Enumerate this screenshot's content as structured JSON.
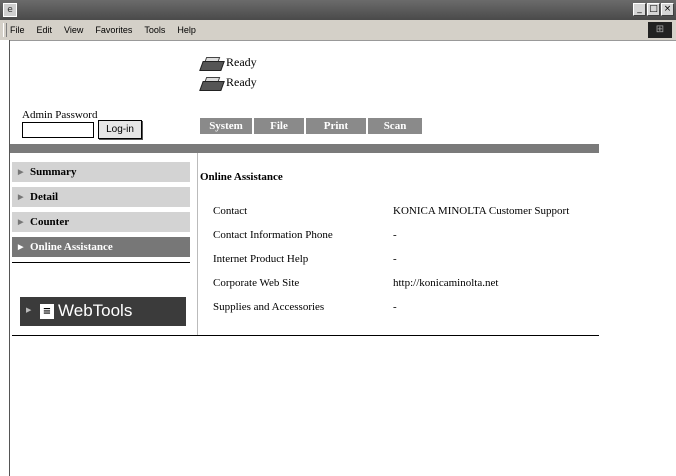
{
  "window": {
    "controls": [
      "_",
      "□",
      "×"
    ]
  },
  "menubar": {
    "items": [
      "File",
      "Edit",
      "View",
      "Favorites",
      "Tools",
      "Help"
    ]
  },
  "status": [
    {
      "icon": "printer-icon",
      "text": "Ready"
    },
    {
      "icon": "printer-icon",
      "text": "Ready"
    }
  ],
  "admin": {
    "label": "Admin Password",
    "password_value": "",
    "login_label": "Log-in"
  },
  "tabs": [
    "System",
    "File",
    "Print",
    "Scan"
  ],
  "sidebar": {
    "items": [
      {
        "label": "Summary",
        "active": false
      },
      {
        "label": "Detail",
        "active": false
      },
      {
        "label": "Counter",
        "active": false
      },
      {
        "label": "Online Assistance",
        "active": true
      }
    ],
    "webtools_label": "WebTools"
  },
  "content": {
    "title": "Online Assistance",
    "rows": [
      {
        "key": "Contact",
        "value": "KONICA MINOLTA Customer Support"
      },
      {
        "key": "Contact Information Phone",
        "value": "-"
      },
      {
        "key": "Internet Product Help",
        "value": "-"
      },
      {
        "key": "Corporate Web Site",
        "value": "http://konicaminolta.net"
      },
      {
        "key": "Supplies and Accessories",
        "value": "-"
      }
    ]
  },
  "colors": {
    "tab_bg": "#8a8a8a",
    "band": "#7a7a7a",
    "nav_bg": "#d3d3d3",
    "nav_active": "#777777",
    "webtools_bg": "#3b3b3b"
  }
}
